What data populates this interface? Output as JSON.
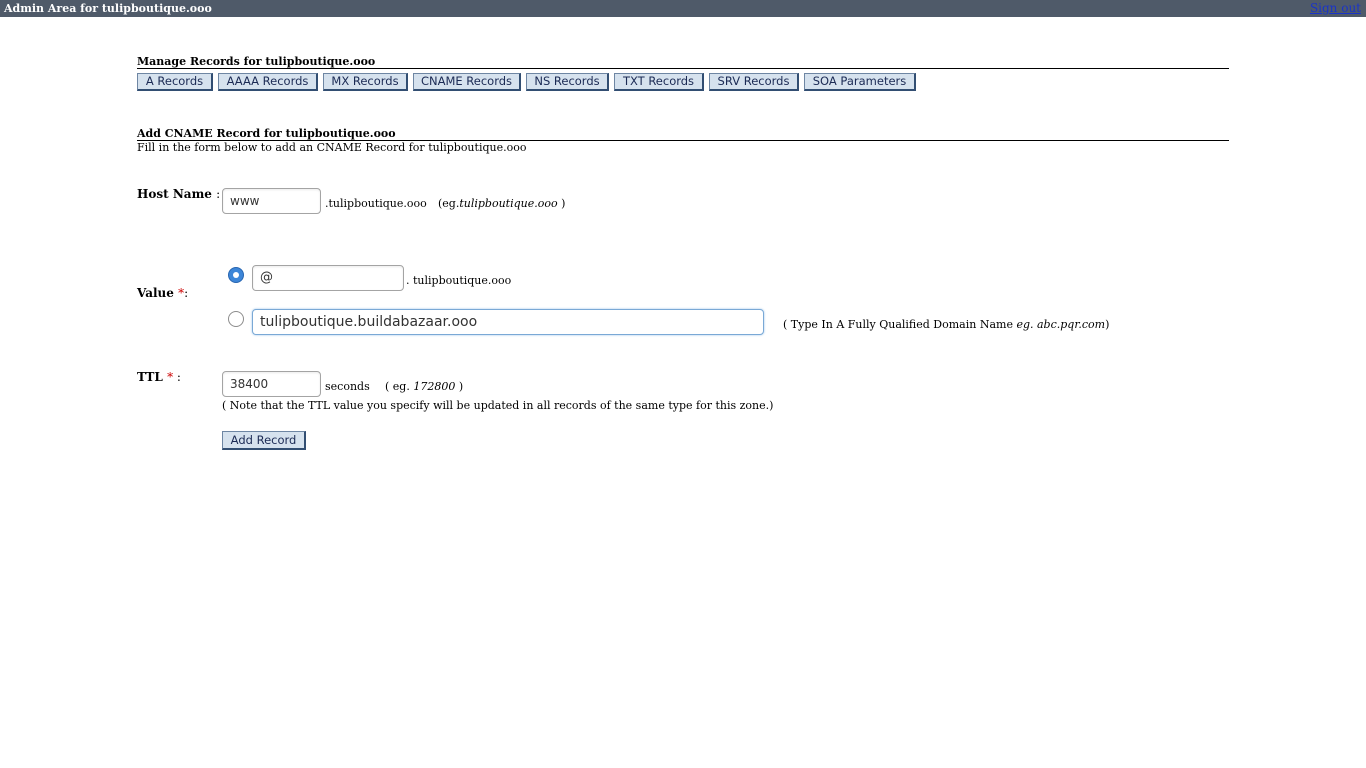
{
  "header": {
    "title": "Admin Area for tulipboutique.ooo",
    "signout": "Sign out"
  },
  "manage": {
    "title": "Manage Records for tulipboutique.ooo",
    "tabs": [
      "A Records",
      "AAAA Records",
      "MX Records",
      "CNAME Records",
      "NS Records",
      "TXT Records",
      "SRV Records",
      "SOA Parameters"
    ]
  },
  "form": {
    "title": "Add CNAME Record for tulipboutique.ooo",
    "instructions": "Fill in the form below to add an CNAME Record for tulipboutique.ooo",
    "host": {
      "label": "Host Name",
      "colon": ":",
      "value": "www",
      "suffix": ".tulipboutique.ooo",
      "example_prefix": "(eg.",
      "example": "tulipboutique.ooo",
      "example_suffix": ")"
    },
    "value": {
      "label": "Value",
      "required": "*",
      "colon": ":",
      "option1": {
        "value": "@",
        "suffix": ". tulipboutique.ooo",
        "selected": true
      },
      "option2": {
        "value": "tulipboutique.buildabazaar.ooo",
        "selected": false,
        "hint_prefix": "( Type In A Fully Qualified Domain Name",
        "hint_example": "eg. abc.pqr.com",
        "hint_suffix": ")"
      }
    },
    "ttl": {
      "label": "TTL",
      "required": "*",
      "colon": ":",
      "value": "38400",
      "unit": "seconds",
      "example_prefix": "( eg.",
      "example": "172800",
      "example_suffix": ")",
      "note": "( Note that the TTL value you specify will be updated in all records of the same type for this zone.)"
    },
    "submit_label": "Add Record"
  }
}
